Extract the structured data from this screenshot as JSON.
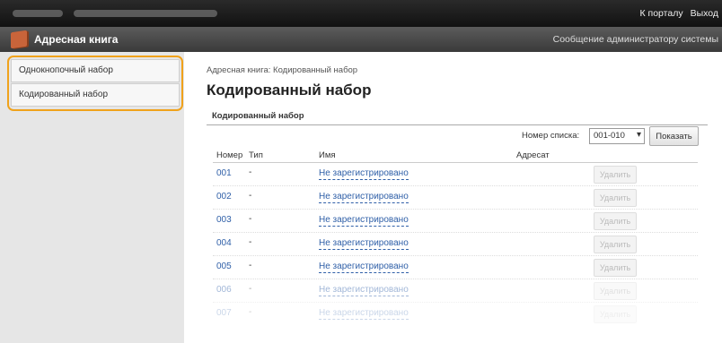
{
  "header": {
    "links": [
      "К порталу",
      "Выход"
    ]
  },
  "titlebar": {
    "title": "Адресная книга",
    "admin_msg": "Сообщение администратору системы"
  },
  "sidebar": {
    "items": [
      {
        "label": "Однокнопочный набор"
      },
      {
        "label": "Кодированный набор"
      }
    ]
  },
  "main": {
    "breadcrumb": "Адресная книга: Кодированный набор",
    "page_title": "Кодированный набор",
    "section_title": "Кодированный набор",
    "list_number_label": "Номер списка:",
    "list_number_value": "001-010",
    "show_button": "Показать",
    "columns": [
      "Номер",
      "Тип",
      "Имя",
      "Адресат"
    ],
    "rows": [
      {
        "num": "001",
        "type": "-",
        "name": "Не зарегистрировано",
        "delete": "Удалить"
      },
      {
        "num": "002",
        "type": "-",
        "name": "Не зарегистрировано",
        "delete": "Удалить"
      },
      {
        "num": "003",
        "type": "-",
        "name": "Не зарегистрировано",
        "delete": "Удалить"
      },
      {
        "num": "004",
        "type": "-",
        "name": "Не зарегистрировано",
        "delete": "Удалить"
      },
      {
        "num": "005",
        "type": "-",
        "name": "Не зарегистрировано",
        "delete": "Удалить"
      },
      {
        "num": "006",
        "type": "-",
        "name": "Не зарегистрировано",
        "delete": "Удалить"
      },
      {
        "num": "007",
        "type": "-",
        "name": "Не зарегистрировано",
        "delete": "Удалить"
      }
    ]
  },
  "colors": {
    "highlight": "#f0a21b",
    "link": "#3060a8",
    "icon": "#c8643a"
  }
}
